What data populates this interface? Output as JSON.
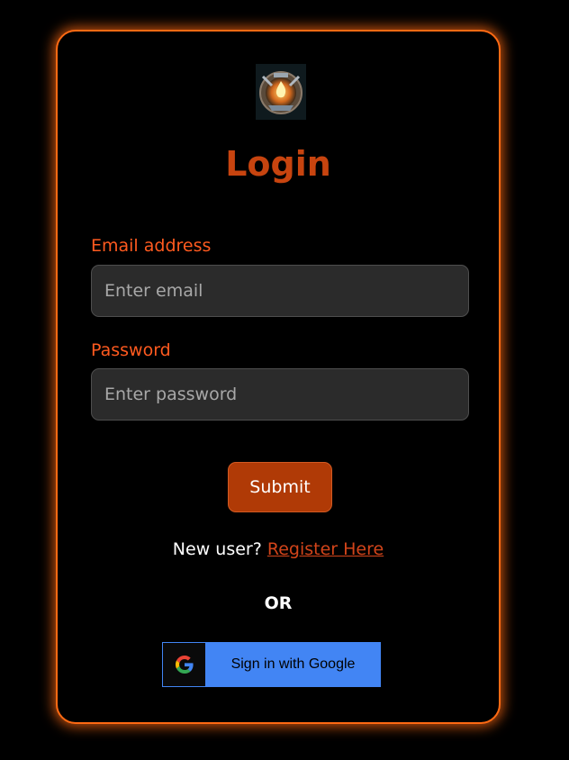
{
  "login": {
    "title": "Login",
    "email_label": "Email address",
    "email_placeholder": "Enter email",
    "email_value": "",
    "password_label": "Password",
    "password_placeholder": "Enter password",
    "password_value": "",
    "submit_label": "Submit",
    "new_user_text": "New user? ",
    "register_link": "Register Here",
    "or_text": "OR",
    "google_label": "Sign in with Google"
  },
  "icons": {
    "logo": "fire-emblem-logo",
    "google": "google-g-icon"
  },
  "colors": {
    "accent": "#ff6a13",
    "title": "#c7440f",
    "label": "#ff5a1f",
    "submit_bg": "#b03a06",
    "link": "#d2441a",
    "google_blue": "#4285f4",
    "input_bg": "#2b2b2b"
  }
}
